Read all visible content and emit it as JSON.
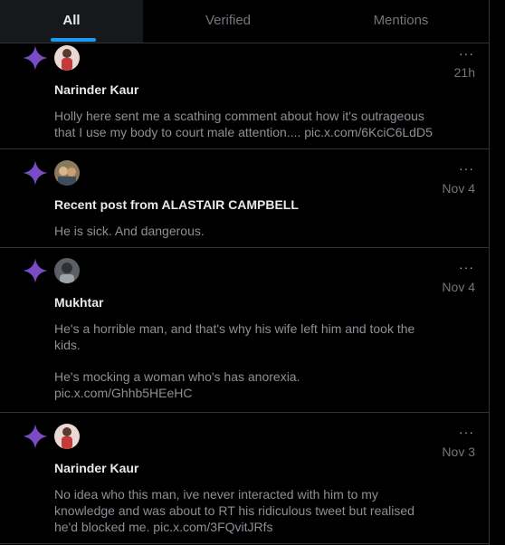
{
  "tabs": [
    {
      "label": "All"
    },
    {
      "label": "Verified"
    },
    {
      "label": "Mentions"
    }
  ],
  "accent_color": "#1d9bf0",
  "star_color": "#794bc4",
  "notifications": [
    {
      "icon": "sparkle-icon",
      "more": "···",
      "time": "21h",
      "prefix": "",
      "title": "Narinder Kaur",
      "lines": [
        "Holly here sent me a scathing comment about how it's outrageous that I use my body to court male attention.... pic.x.com/6KciC6LdD5"
      ]
    },
    {
      "icon": "sparkle-icon",
      "more": "···",
      "time": "Nov 4",
      "prefix": "Recent post from ",
      "title": "ALASTAIR CAMPBELL",
      "lines": [
        "He is sick. And dangerous."
      ]
    },
    {
      "icon": "sparkle-icon",
      "more": "···",
      "time": "Nov 4",
      "prefix": "",
      "title": "Mukhtar",
      "lines": [
        "He's a horrible man, and that's why his wife left him and took the kids.",
        "He's mocking a woman who's has anorexia. pic.x.com/Ghhb5HEeHC"
      ]
    },
    {
      "icon": "sparkle-icon",
      "more": "···",
      "time": "Nov 3",
      "prefix": "",
      "title": "Narinder Kaur",
      "lines": [
        "No idea who this man, ive never interacted with him to my knowledge and was about to RT his ridiculous tweet but realised he'd blocked me. pic.x.com/3FQvitJRfs"
      ]
    }
  ]
}
